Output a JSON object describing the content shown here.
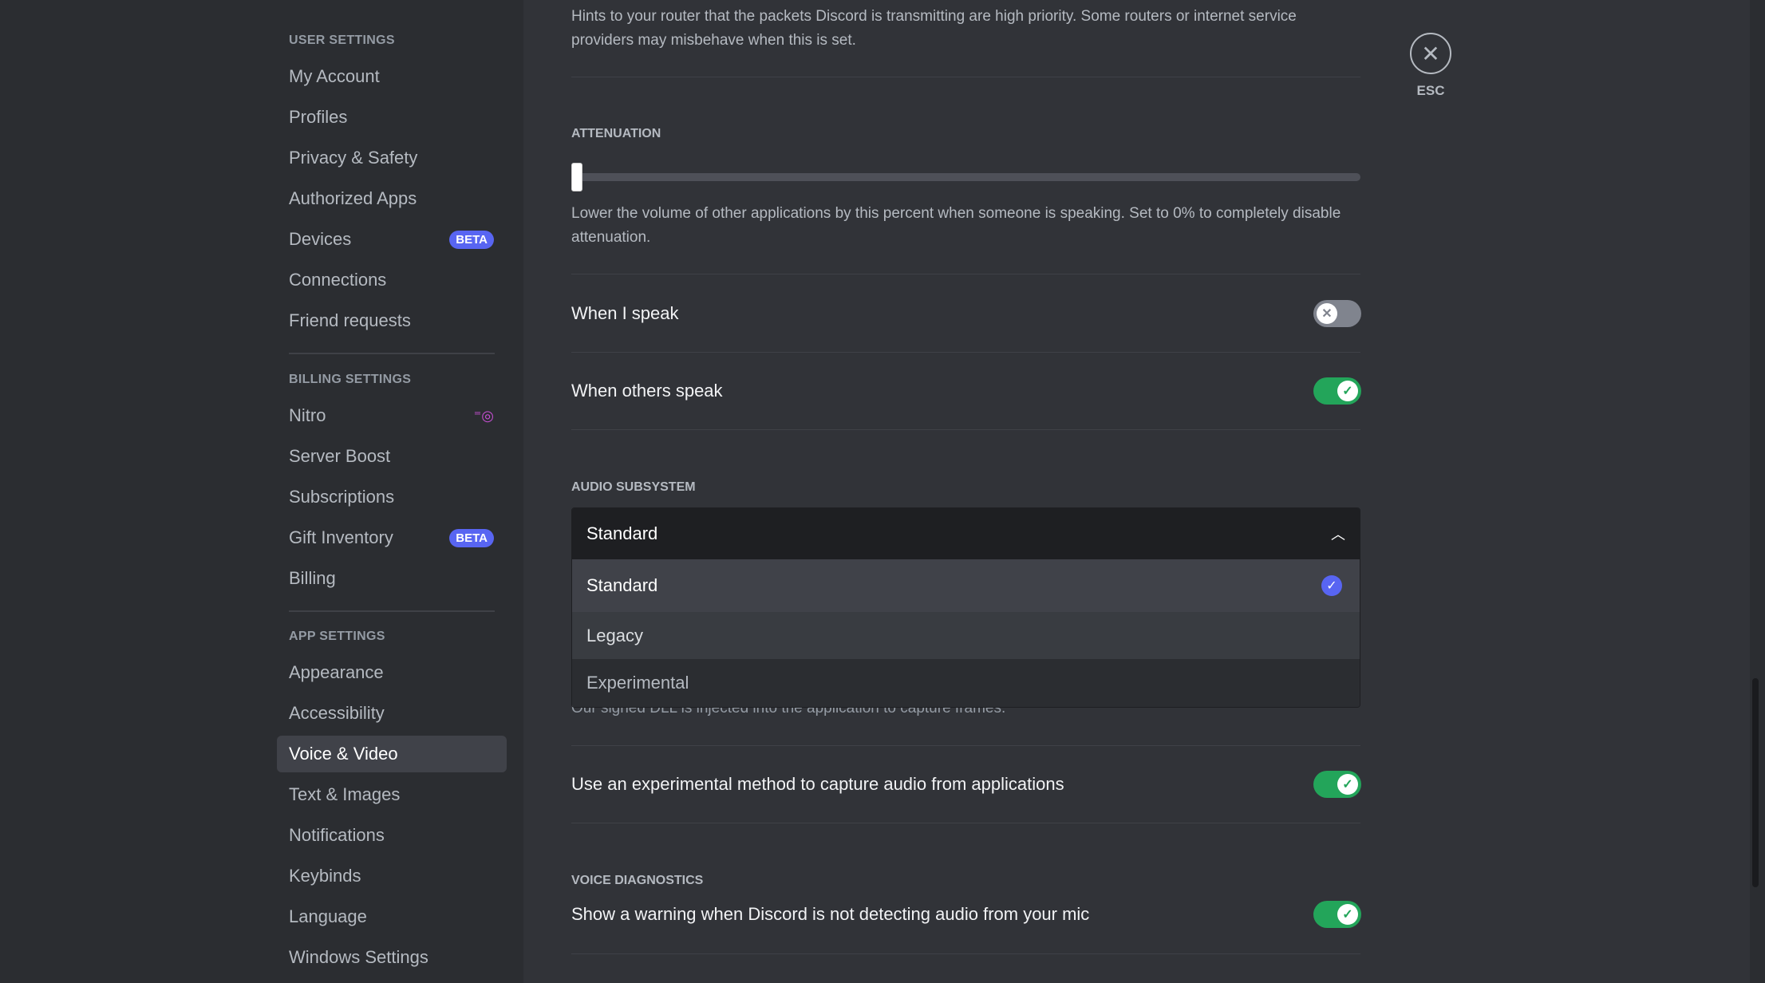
{
  "sidebar": {
    "user_header": "USER SETTINGS",
    "user_items": [
      "My Account",
      "Profiles",
      "Privacy & Safety",
      "Authorized Apps",
      "Devices",
      "Connections",
      "Friend requests"
    ],
    "billing_header": "BILLING SETTINGS",
    "billing_items": [
      "Nitro",
      "Server Boost",
      "Subscriptions",
      "Gift Inventory",
      "Billing"
    ],
    "app_header": "APP SETTINGS",
    "app_items": [
      "Appearance",
      "Accessibility",
      "Voice & Video",
      "Text & Images",
      "Notifications",
      "Keybinds",
      "Language",
      "Windows Settings"
    ],
    "beta_badge": "BETA",
    "selected": "Voice & Video"
  },
  "content": {
    "qos_desc": "Hints to your router that the packets Discord is transmitting are high priority. Some routers or internet service providers may misbehave when this is set.",
    "attenuation": {
      "header": "ATTENUATION",
      "value_percent": 0,
      "desc": "Lower the volume of other applications by this percent when someone is speaking. Set to 0% to completely disable attenuation."
    },
    "when_i_speak": {
      "label": "When I speak",
      "on": false
    },
    "when_others_speak": {
      "label": "When others speak",
      "on": true
    },
    "audio_subsystem": {
      "header": "AUDIO SUBSYSTEM",
      "selected": "Standard",
      "options": [
        "Standard",
        "Legacy",
        "Experimental"
      ]
    },
    "hidden_desc": "Our signed DLL is injected into the application to capture frames.",
    "experimental_capture": {
      "label": "Use an experimental method to capture audio from applications",
      "on": true
    },
    "voice_diagnostics": {
      "header": "VOICE DIAGNOSTICS",
      "label": "Show a warning when Discord is not detecting audio from your mic",
      "on": true
    }
  },
  "close": {
    "label": "ESC"
  },
  "colors": {
    "accent": "#5865f2",
    "toggle_on": "#23a55a",
    "toggle_off": "#80848e",
    "nitro": "#c94fd6"
  }
}
